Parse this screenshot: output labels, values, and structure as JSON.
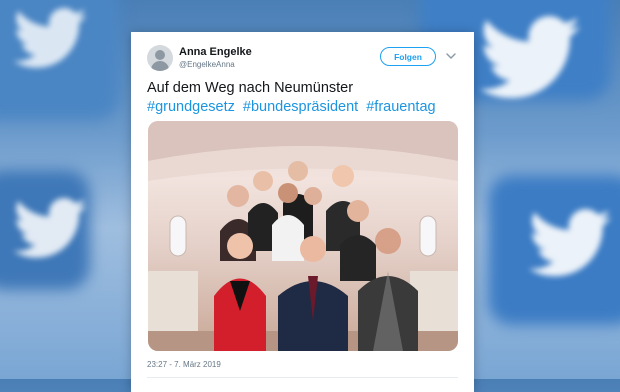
{
  "tweet": {
    "author_name": "Anna Engelke",
    "author_handle": "@EngelkeAnna",
    "follow_label": "Folgen",
    "text": "Auf dem Weg nach Neumünster",
    "hashtags": [
      "#grundgesetz",
      "#bundespräsident",
      "#frauentag"
    ],
    "timestamp": "23:27 - 7. März 2019"
  },
  "colors": {
    "accent": "#1da1f2",
    "hashtag": "#1b95e0",
    "background": "#5b8fc7"
  },
  "icons": [
    "avatar-placeholder-icon",
    "chevron-down-icon",
    "twitter-bird-icon"
  ]
}
